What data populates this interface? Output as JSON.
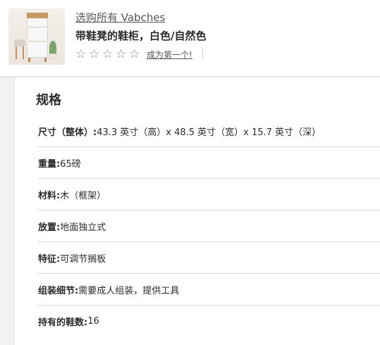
{
  "product": {
    "brand_link": "选购所有 Vabches",
    "title": "带鞋凳的鞋柜，白色/自然色",
    "rating": {
      "stars_filled": 0,
      "stars_total": 5,
      "star_glyph": "☆",
      "first_review_link": "成为第一个!"
    }
  },
  "specs": {
    "heading": "规格",
    "rows": [
      {
        "key": "尺寸（整体）:",
        "value": "43.3 英寸（高）x 48.5 英寸（宽）x 15.7 英寸（深）"
      },
      {
        "key": "重量:",
        "value": "65磅"
      },
      {
        "key": "材料:",
        "value": " 木（框架）"
      },
      {
        "key": "放置:",
        "value": "地面独立式"
      },
      {
        "key": "特征:",
        "value": " 可调节搁板"
      },
      {
        "key": "组装细节:",
        "value": "需要成人组装，提供工具"
      },
      {
        "key": "持有的鞋数:",
        "value": "16"
      }
    ]
  },
  "colors": {
    "page_bg": "#f2f2f2",
    "text": "#2b2b2b",
    "muted": "#555555",
    "divider": "#dcdcdc"
  }
}
